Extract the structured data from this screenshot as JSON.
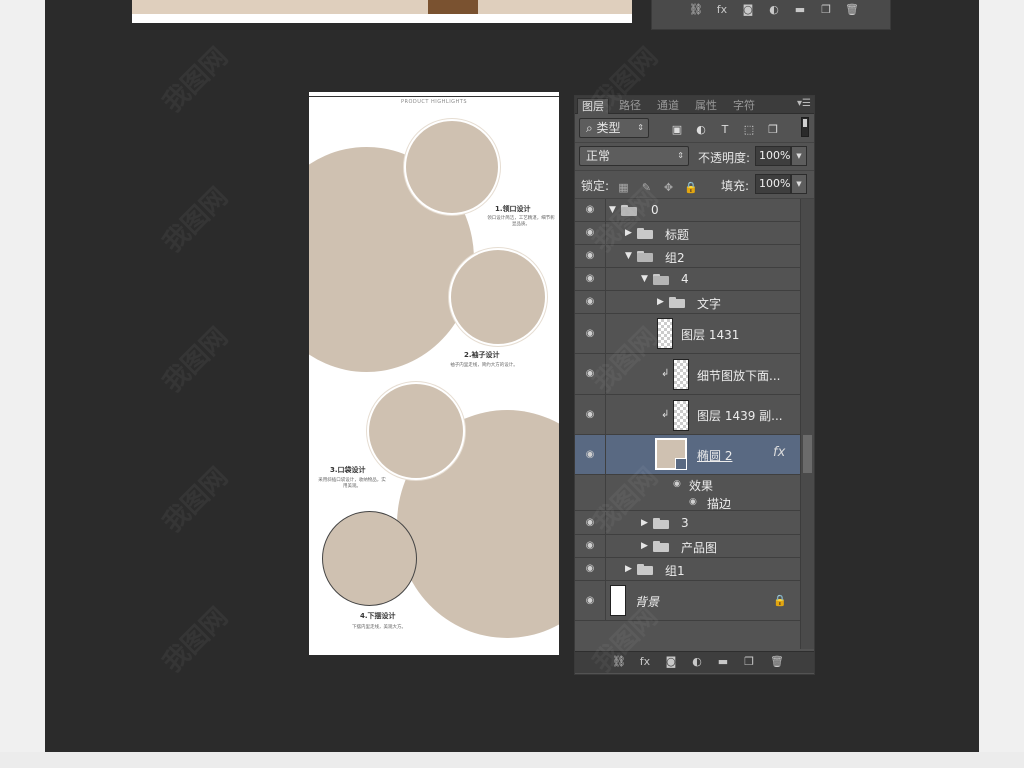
{
  "doc": {
    "header": "PRODUCT HIGHLIGHTS",
    "features": [
      {
        "title": "1.领口设计",
        "desc": "领口设计简洁，工艺精湛，细节彰显品质。"
      },
      {
        "title": "2.袖子设计",
        "desc": "袖子内里走线，简约大方的设计。"
      },
      {
        "title": "3.口袋设计",
        "desc": "采用斜插口袋设计，收纳物品，实用美观。"
      },
      {
        "title": "4.下摆设计",
        "desc": "下摆内里走线，美观大方。"
      }
    ]
  },
  "panel": {
    "tabs": [
      "图层",
      "路径",
      "通道",
      "属性",
      "字符"
    ],
    "active_tab": "图层",
    "filter_type": "类型",
    "blend_mode": "正常",
    "opacity_label": "不透明度:",
    "opacity_value": "100%",
    "lock_label": "锁定:",
    "fill_label": "填充:",
    "fill_value": "100%",
    "layers": [
      {
        "name": "0",
        "kind": "group-open"
      },
      {
        "name": "标题",
        "kind": "group-closed"
      },
      {
        "name": "组2",
        "kind": "group-open"
      },
      {
        "name": "4",
        "kind": "group-open"
      },
      {
        "name": "文字",
        "kind": "group-closed"
      },
      {
        "name": "图层 1431",
        "kind": "layer"
      },
      {
        "name": "细节图放下面...",
        "kind": "layer-clipped"
      },
      {
        "name": "图层 1439 副...",
        "kind": "layer-clipped"
      },
      {
        "name": "椭圆 2",
        "kind": "shape-selected"
      },
      {
        "name": "效果",
        "kind": "effect"
      },
      {
        "name": "描边",
        "kind": "effect-item"
      },
      {
        "name": "3",
        "kind": "group-closed"
      },
      {
        "name": "产品图",
        "kind": "group-closed"
      },
      {
        "name": "组1",
        "kind": "group-closed"
      },
      {
        "name": "背景",
        "kind": "background"
      }
    ],
    "fx_label": "fx"
  },
  "watermark_text": "我图网",
  "colors": {
    "workspace": "#2b2b2b",
    "panel": "#535353",
    "selected_row": "#596982",
    "circle_fill": "#cfc1b1"
  }
}
